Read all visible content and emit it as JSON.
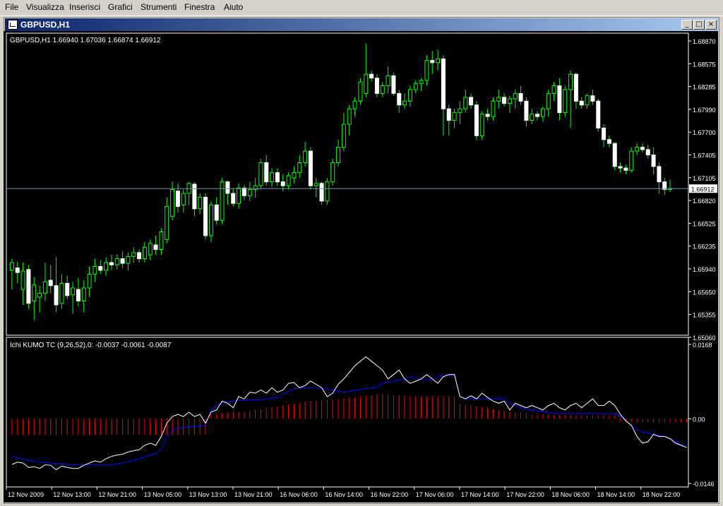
{
  "menu": {
    "items": [
      "File",
      "Visualizza",
      "Inserisci",
      "Grafici",
      "Strumenti",
      "Finestra",
      "Aiuto"
    ]
  },
  "window": {
    "title": "GBPUSD,H1",
    "buttons": {
      "minimize": "_",
      "restore": "□",
      "close": "×"
    }
  },
  "colors": {
    "background": "#000000",
    "grid_text": "#ffffff",
    "bull_candle": "#000000",
    "bull_outline": "#00ff00",
    "bear_candle": "#ffffff",
    "bid_line": "#7a8fa8",
    "white_line": "#ffffff",
    "blue_line": "#0000ff",
    "histogram": "#ff0000"
  },
  "price_panel": {
    "info": "GBPUSD,H1  1.66940 1.67036 1.66874 1.66912",
    "price_labels": [
      "1.68870",
      "1.68575",
      "1.68285",
      "1.67990",
      "1.67700",
      "1.67405",
      "1.67105",
      "1.66820",
      "1.66525",
      "1.66235",
      "1.65940",
      "1.65650",
      "1.65355",
      "1.65060"
    ],
    "current_price": "1.66912"
  },
  "indicator_panel": {
    "info": "Ichi KUMO TC (9,26,52),0:  -0.0037 -0.0061 -0.0087",
    "labels": [
      "0.0168",
      "0.00",
      "-0.0146"
    ]
  },
  "time_axis": {
    "labels": [
      "12 Nov 2009",
      "12 Nov 13:00",
      "12 Nov 21:00",
      "13 Nov 05:00",
      "13 Nov 13:00",
      "13 Nov 21:00",
      "16 Nov 06:00",
      "16 Nov 14:00",
      "16 Nov 22:00",
      "17 Nov 06:00",
      "17 Nov 14:00",
      "17 Nov 22:00",
      "18 Nov 06:00",
      "18 Nov 14:00",
      "18 Nov 22:00"
    ]
  },
  "chart_data": {
    "type": "candlestick",
    "symbol": "GBPUSD",
    "timeframe": "H1",
    "ylim": [
      1.6506,
      1.6887
    ],
    "current_price": 1.66912,
    "ohlc": [
      {
        "o": 1.6585,
        "h": 1.66,
        "l": 1.656,
        "c": 1.6595
      },
      {
        "o": 1.6588,
        "h": 1.6596,
        "l": 1.6568,
        "c": 1.6582
      },
      {
        "o": 1.656,
        "h": 1.6595,
        "l": 1.654,
        "c": 1.6584
      },
      {
        "o": 1.6586,
        "h": 1.6592,
        "l": 1.6535,
        "c": 1.6542
      },
      {
        "o": 1.6545,
        "h": 1.6576,
        "l": 1.652,
        "c": 1.6566
      },
      {
        "o": 1.655,
        "h": 1.6565,
        "l": 1.653,
        "c": 1.6555
      },
      {
        "o": 1.6555,
        "h": 1.6595,
        "l": 1.6545,
        "c": 1.657
      },
      {
        "o": 1.6572,
        "h": 1.6592,
        "l": 1.6555,
        "c": 1.6565
      },
      {
        "o": 1.6565,
        "h": 1.6602,
        "l": 1.653,
        "c": 1.654
      },
      {
        "o": 1.6542,
        "h": 1.658,
        "l": 1.6535,
        "c": 1.6568
      },
      {
        "o": 1.6568,
        "h": 1.6578,
        "l": 1.6547,
        "c": 1.6552
      },
      {
        "o": 1.6553,
        "h": 1.657,
        "l": 1.6528,
        "c": 1.6562
      },
      {
        "o": 1.656,
        "h": 1.6575,
        "l": 1.6538,
        "c": 1.6545
      },
      {
        "o": 1.6545,
        "h": 1.6572,
        "l": 1.653,
        "c": 1.6562
      },
      {
        "o": 1.6562,
        "h": 1.659,
        "l": 1.655,
        "c": 1.658
      },
      {
        "o": 1.658,
        "h": 1.66,
        "l": 1.657,
        "c": 1.659
      },
      {
        "o": 1.659,
        "h": 1.6598,
        "l": 1.658,
        "c": 1.6585
      },
      {
        "o": 1.6585,
        "h": 1.6602,
        "l": 1.6578,
        "c": 1.6595
      },
      {
        "o": 1.6595,
        "h": 1.6605,
        "l": 1.6585,
        "c": 1.6592
      },
      {
        "o": 1.6592,
        "h": 1.6606,
        "l": 1.6586,
        "c": 1.66
      },
      {
        "o": 1.66,
        "h": 1.661,
        "l": 1.6588,
        "c": 1.6594
      },
      {
        "o": 1.6594,
        "h": 1.6608,
        "l": 1.6585,
        "c": 1.6603
      },
      {
        "o": 1.6603,
        "h": 1.6615,
        "l": 1.6595,
        "c": 1.6608
      },
      {
        "o": 1.6608,
        "h": 1.6612,
        "l": 1.6595,
        "c": 1.66
      },
      {
        "o": 1.66,
        "h": 1.6622,
        "l": 1.6595,
        "c": 1.6615
      },
      {
        "o": 1.6605,
        "h": 1.6625,
        "l": 1.6598,
        "c": 1.662
      },
      {
        "o": 1.6618,
        "h": 1.663,
        "l": 1.6605,
        "c": 1.6612
      },
      {
        "o": 1.6612,
        "h": 1.664,
        "l": 1.6605,
        "c": 1.6635
      },
      {
        "o": 1.6625,
        "h": 1.668,
        "l": 1.662,
        "c": 1.6668
      },
      {
        "o": 1.6655,
        "h": 1.67,
        "l": 1.665,
        "c": 1.669
      },
      {
        "o": 1.6688,
        "h": 1.6698,
        "l": 1.666,
        "c": 1.6668
      },
      {
        "o": 1.667,
        "h": 1.669,
        "l": 1.666,
        "c": 1.6685
      },
      {
        "o": 1.6685,
        "h": 1.67,
        "l": 1.667,
        "c": 1.6698
      },
      {
        "o": 1.6697,
        "h": 1.67,
        "l": 1.6655,
        "c": 1.6665
      },
      {
        "o": 1.6665,
        "h": 1.6685,
        "l": 1.6658,
        "c": 1.668
      },
      {
        "o": 1.668,
        "h": 1.6685,
        "l": 1.6625,
        "c": 1.663
      },
      {
        "o": 1.663,
        "h": 1.6675,
        "l": 1.6622,
        "c": 1.667
      },
      {
        "o": 1.667,
        "h": 1.668,
        "l": 1.6645,
        "c": 1.665
      },
      {
        "o": 1.665,
        "h": 1.6705,
        "l": 1.6645,
        "c": 1.67
      },
      {
        "o": 1.67,
        "h": 1.6702,
        "l": 1.667,
        "c": 1.6685
      },
      {
        "o": 1.6685,
        "h": 1.6692,
        "l": 1.6668,
        "c": 1.6672
      },
      {
        "o": 1.6672,
        "h": 1.6698,
        "l": 1.6665,
        "c": 1.6692
      },
      {
        "o": 1.6692,
        "h": 1.6696,
        "l": 1.6676,
        "c": 1.6682
      },
      {
        "o": 1.6682,
        "h": 1.67,
        "l": 1.6675,
        "c": 1.669
      },
      {
        "o": 1.669,
        "h": 1.6705,
        "l": 1.668,
        "c": 1.6695
      },
      {
        "o": 1.6695,
        "h": 1.673,
        "l": 1.669,
        "c": 1.6725
      },
      {
        "o": 1.6725,
        "h": 1.6735,
        "l": 1.6695,
        "c": 1.67
      },
      {
        "o": 1.67,
        "h": 1.6718,
        "l": 1.6693,
        "c": 1.6712
      },
      {
        "o": 1.6712,
        "h": 1.6718,
        "l": 1.6695,
        "c": 1.67
      },
      {
        "o": 1.67,
        "h": 1.671,
        "l": 1.6688,
        "c": 1.6695
      },
      {
        "o": 1.6695,
        "h": 1.6712,
        "l": 1.669,
        "c": 1.6708
      },
      {
        "o": 1.6705,
        "h": 1.672,
        "l": 1.6698,
        "c": 1.6712
      },
      {
        "o": 1.6712,
        "h": 1.6735,
        "l": 1.6705,
        "c": 1.6725
      },
      {
        "o": 1.6725,
        "h": 1.6752,
        "l": 1.672,
        "c": 1.674
      },
      {
        "o": 1.674,
        "h": 1.6745,
        "l": 1.669,
        "c": 1.6695
      },
      {
        "o": 1.6695,
        "h": 1.6705,
        "l": 1.668,
        "c": 1.6698
      },
      {
        "o": 1.6698,
        "h": 1.67,
        "l": 1.667,
        "c": 1.6675
      },
      {
        "o": 1.6675,
        "h": 1.6705,
        "l": 1.667,
        "c": 1.67
      },
      {
        "o": 1.67,
        "h": 1.673,
        "l": 1.6695,
        "c": 1.6725
      },
      {
        "o": 1.6725,
        "h": 1.6755,
        "l": 1.672,
        "c": 1.6745
      },
      {
        "o": 1.6745,
        "h": 1.679,
        "l": 1.674,
        "c": 1.6775
      },
      {
        "o": 1.6775,
        "h": 1.68,
        "l": 1.676,
        "c": 1.6795
      },
      {
        "o": 1.6795,
        "h": 1.681,
        "l": 1.6785,
        "c": 1.6805
      },
      {
        "o": 1.6805,
        "h": 1.6835,
        "l": 1.68,
        "c": 1.683
      },
      {
        "o": 1.6815,
        "h": 1.688,
        "l": 1.681,
        "c": 1.684
      },
      {
        "o": 1.684,
        "h": 1.6845,
        "l": 1.683,
        "c": 1.6835
      },
      {
        "o": 1.6835,
        "h": 1.684,
        "l": 1.681,
        "c": 1.6815
      },
      {
        "o": 1.6815,
        "h": 1.683,
        "l": 1.681,
        "c": 1.6825
      },
      {
        "o": 1.6825,
        "h": 1.685,
        "l": 1.6815,
        "c": 1.6838
      },
      {
        "o": 1.6838,
        "h": 1.6842,
        "l": 1.6812,
        "c": 1.6815
      },
      {
        "o": 1.6815,
        "h": 1.682,
        "l": 1.679,
        "c": 1.68
      },
      {
        "o": 1.68,
        "h": 1.6815,
        "l": 1.6795,
        "c": 1.6805
      },
      {
        "o": 1.6805,
        "h": 1.6825,
        "l": 1.6798,
        "c": 1.682
      },
      {
        "o": 1.682,
        "h": 1.6832,
        "l": 1.6815,
        "c": 1.6828
      },
      {
        "o": 1.6828,
        "h": 1.6835,
        "l": 1.6818,
        "c": 1.6832
      },
      {
        "o": 1.6832,
        "h": 1.6865,
        "l": 1.6825,
        "c": 1.6858
      },
      {
        "o": 1.6858,
        "h": 1.687,
        "l": 1.684,
        "c": 1.6855
      },
      {
        "o": 1.6855,
        "h": 1.6872,
        "l": 1.6845,
        "c": 1.686
      },
      {
        "o": 1.686,
        "h": 1.6865,
        "l": 1.676,
        "c": 1.6795
      },
      {
        "o": 1.6795,
        "h": 1.68,
        "l": 1.676,
        "c": 1.678
      },
      {
        "o": 1.678,
        "h": 1.6795,
        "l": 1.677,
        "c": 1.679
      },
      {
        "o": 1.679,
        "h": 1.6805,
        "l": 1.6775,
        "c": 1.6795
      },
      {
        "o": 1.6795,
        "h": 1.682,
        "l": 1.679,
        "c": 1.681
      },
      {
        "o": 1.681,
        "h": 1.6815,
        "l": 1.6795,
        "c": 1.68
      },
      {
        "o": 1.68,
        "h": 1.6805,
        "l": 1.6755,
        "c": 1.676
      },
      {
        "o": 1.676,
        "h": 1.6792,
        "l": 1.6755,
        "c": 1.6788
      },
      {
        "o": 1.6788,
        "h": 1.6795,
        "l": 1.678,
        "c": 1.6785
      },
      {
        "o": 1.6785,
        "h": 1.681,
        "l": 1.678,
        "c": 1.6805
      },
      {
        "o": 1.6805,
        "h": 1.682,
        "l": 1.6795,
        "c": 1.681
      },
      {
        "o": 1.681,
        "h": 1.6815,
        "l": 1.6798,
        "c": 1.6802
      },
      {
        "o": 1.6802,
        "h": 1.6812,
        "l": 1.679,
        "c": 1.6808
      },
      {
        "o": 1.6808,
        "h": 1.682,
        "l": 1.6795,
        "c": 1.6815
      },
      {
        "o": 1.6815,
        "h": 1.6825,
        "l": 1.68,
        "c": 1.6805
      },
      {
        "o": 1.6805,
        "h": 1.681,
        "l": 1.6772,
        "c": 1.678
      },
      {
        "o": 1.678,
        "h": 1.6795,
        "l": 1.6775,
        "c": 1.6788
      },
      {
        "o": 1.6788,
        "h": 1.6792,
        "l": 1.678,
        "c": 1.6785
      },
      {
        "o": 1.6785,
        "h": 1.6798,
        "l": 1.6778,
        "c": 1.6795
      },
      {
        "o": 1.6795,
        "h": 1.682,
        "l": 1.6785,
        "c": 1.6815
      },
      {
        "o": 1.6815,
        "h": 1.683,
        "l": 1.6805,
        "c": 1.6825
      },
      {
        "o": 1.6825,
        "h": 1.6835,
        "l": 1.678,
        "c": 1.679
      },
      {
        "o": 1.679,
        "h": 1.6825,
        "l": 1.6785,
        "c": 1.682
      },
      {
        "o": 1.682,
        "h": 1.6845,
        "l": 1.677,
        "c": 1.684
      },
      {
        "o": 1.684,
        "h": 1.6842,
        "l": 1.6795,
        "c": 1.6805
      },
      {
        "o": 1.6805,
        "h": 1.681,
        "l": 1.6795,
        "c": 1.68
      },
      {
        "o": 1.68,
        "h": 1.6815,
        "l": 1.6795,
        "c": 1.6812
      },
      {
        "o": 1.6812,
        "h": 1.682,
        "l": 1.68,
        "c": 1.6805
      },
      {
        "o": 1.6805,
        "h": 1.6808,
        "l": 1.6765,
        "c": 1.677
      },
      {
        "o": 1.677,
        "h": 1.6775,
        "l": 1.6745,
        "c": 1.6755
      },
      {
        "o": 1.6755,
        "h": 1.676,
        "l": 1.6745,
        "c": 1.675
      },
      {
        "o": 1.675,
        "h": 1.6752,
        "l": 1.6715,
        "c": 1.672
      },
      {
        "o": 1.672,
        "h": 1.6725,
        "l": 1.6712,
        "c": 1.6718
      },
      {
        "o": 1.6718,
        "h": 1.6722,
        "l": 1.671,
        "c": 1.6715
      },
      {
        "o": 1.6715,
        "h": 1.6745,
        "l": 1.6712,
        "c": 1.674
      },
      {
        "o": 1.674,
        "h": 1.675,
        "l": 1.6735,
        "c": 1.6745
      },
      {
        "o": 1.6745,
        "h": 1.675,
        "l": 1.6738,
        "c": 1.6742
      },
      {
        "o": 1.6742,
        "h": 1.6748,
        "l": 1.673,
        "c": 1.6735
      },
      {
        "o": 1.6735,
        "h": 1.6745,
        "l": 1.671,
        "c": 1.672
      },
      {
        "o": 1.672,
        "h": 1.6725,
        "l": 1.6685,
        "c": 1.67
      },
      {
        "o": 1.67,
        "h": 1.6705,
        "l": 1.6683,
        "c": 1.669
      },
      {
        "o": 1.669,
        "h": 1.6703,
        "l": 1.6687,
        "c": 1.66912
      }
    ],
    "indicator": {
      "name": "Ichi KUMO TC (9,26,52)",
      "ylim": [
        -0.0146,
        0.0168
      ],
      "histogram": [
        -0.0037,
        -0.0037,
        -0.0037,
        -0.0037,
        -0.0037,
        -0.0037,
        -0.0037,
        -0.0037,
        -0.0037,
        -0.0037,
        -0.0037,
        -0.0037,
        -0.0037,
        -0.0037,
        -0.0037,
        -0.0037,
        -0.0037,
        -0.0037,
        -0.0037,
        -0.0037,
        -0.0037,
        -0.0037,
        -0.0037,
        -0.0037,
        -0.0037,
        -0.0037,
        -0.0037,
        -0.0037,
        -0.0037,
        -0.0037,
        -0.0037,
        -0.0037,
        -0.0037,
        -0.0037,
        -0.0037,
        -0.0037,
        0.001,
        0.0011,
        0.0012,
        0.0013,
        0.0014,
        0.0015,
        0.0016,
        0.0018,
        0.002,
        0.0022,
        0.0024,
        0.0026,
        0.0028,
        0.003,
        0.0032,
        0.0034,
        0.0036,
        0.0038,
        0.004,
        0.0041,
        0.0042,
        0.0043,
        0.0044,
        0.0045,
        0.0046,
        0.0047,
        0.0048,
        0.005,
        0.0052,
        0.0054,
        0.0055,
        0.0056,
        0.0055,
        0.0054,
        0.0053,
        0.0052,
        0.0051,
        0.005,
        0.005,
        0.005,
        0.005,
        0.005,
        0.005,
        0.005,
        0.005,
        0.0035,
        0.0032,
        0.003,
        0.0028,
        0.0026,
        0.0024,
        0.0022,
        0.002,
        0.0018,
        0.0016,
        0.0014,
        0.0012,
        0.0012,
        0.001,
        0.001,
        0.001,
        0.001,
        0.0008,
        0.0008,
        0.0008,
        0.0008,
        0.0008,
        0.0008,
        0.0008,
        0.0008,
        0.0008,
        0.0008,
        0.0008,
        0.0008,
        -0.0005,
        -0.0006,
        -0.0007,
        -0.0007,
        -0.0007,
        -0.0008,
        -0.0008,
        -0.0008,
        -0.0008,
        -0.0008,
        -0.0008,
        -0.0009,
        -0.0009
      ],
      "white": [
        -0.0103,
        -0.0098,
        -0.01,
        -0.011,
        -0.0108,
        -0.0112,
        -0.0104,
        -0.0105,
        -0.0115,
        -0.0107,
        -0.011,
        -0.0112,
        -0.0112,
        -0.0105,
        -0.01,
        -0.0095,
        -0.0098,
        -0.009,
        -0.0085,
        -0.0082,
        -0.008,
        -0.0075,
        -0.0072,
        -0.007,
        -0.006,
        -0.0055,
        -0.006,
        -0.004,
        -0.001,
        0.0005,
        0.001,
        0.0005,
        0.0015,
        0.0005,
        0.001,
        -0.001,
        0.0015,
        0.002,
        0.004,
        0.0035,
        0.0025,
        0.005,
        0.0045,
        0.006,
        0.0058,
        0.0065,
        0.0058,
        0.007,
        0.006,
        0.0065,
        0.008,
        0.0082,
        0.007,
        0.0075,
        0.0085,
        0.0078,
        0.007,
        0.005,
        0.0058,
        0.0078,
        0.009,
        0.0105,
        0.012,
        0.013,
        0.014,
        0.013,
        0.012,
        0.011,
        0.009,
        0.01,
        0.011,
        0.009,
        0.008,
        0.0085,
        0.009,
        0.01,
        0.009,
        0.008,
        0.0095,
        0.01,
        0.01,
        0.005,
        0.0045,
        0.0052,
        0.0045,
        0.0058,
        0.0048,
        0.004,
        0.0035,
        0.004,
        0.002,
        0.0035,
        0.003,
        0.0025,
        0.003,
        0.0025,
        0.002,
        0.003,
        0.0035,
        0.0025,
        0.002,
        0.003,
        0.0035,
        0.0025,
        0.0035,
        0.0045,
        0.003,
        0.003,
        0.004,
        0.003,
        0.001,
        -0.0005,
        -0.0015,
        -0.004,
        -0.0055,
        -0.0052,
        -0.0035,
        -0.004,
        -0.004,
        -0.0045,
        -0.0055,
        -0.006,
        -0.0065
      ],
      "blue": [
        -0.0085,
        -0.0088,
        -0.0091,
        -0.0094,
        -0.0096,
        -0.0098,
        -0.0099,
        -0.01,
        -0.0101,
        -0.0102,
        -0.0103,
        -0.0104,
        -0.0104,
        -0.0104,
        -0.0104,
        -0.0104,
        -0.0104,
        -0.0104,
        -0.0104,
        -0.0102,
        -0.01,
        -0.0097,
        -0.0094,
        -0.009,
        -0.0086,
        -0.0082,
        -0.0078,
        -0.007,
        -0.004,
        -0.0025,
        -0.0022,
        -0.002,
        -0.0018,
        -0.0017,
        -0.0016,
        -0.0015,
        0.002,
        0.003,
        0.0035,
        0.0038,
        0.004,
        0.0042,
        0.0042,
        0.0042,
        0.0043,
        0.0043,
        0.0045,
        0.0046,
        0.0048,
        0.0055,
        0.0062,
        0.0068,
        0.007,
        0.007,
        0.007,
        0.0069,
        0.0069,
        0.0068,
        0.0065,
        0.0062,
        0.006,
        0.0062,
        0.0065,
        0.0066,
        0.0068,
        0.007,
        0.0072,
        0.008,
        0.0083,
        0.0085,
        0.0088,
        0.009,
        0.0095,
        0.0092,
        0.009,
        0.0088,
        0.009,
        0.0095,
        0.0098,
        0.0098,
        0.0098,
        0.005,
        0.0045,
        0.0045,
        0.0045,
        0.0045,
        0.0045,
        0.0045,
        0.0045,
        0.0045,
        0.0035,
        0.003,
        0.0025,
        0.0022,
        0.002,
        0.0018,
        0.0016,
        0.0014,
        0.0013,
        0.0012,
        0.0012,
        0.0012,
        0.0012,
        0.0012,
        0.0012,
        0.0012,
        0.0012,
        0.0012,
        0.0012,
        0.0012,
        0.0005,
        -0.0005,
        -0.0015,
        -0.0025,
        -0.003,
        -0.0032,
        -0.0035,
        -0.0037,
        -0.004,
        -0.0045,
        -0.005,
        -0.006,
        -0.0061
      ]
    }
  }
}
